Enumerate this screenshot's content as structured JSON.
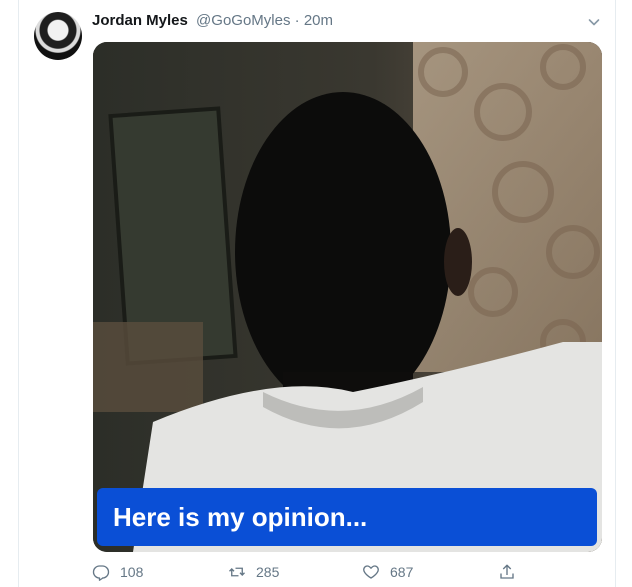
{
  "tweet": {
    "author_name": "Jordan Myles",
    "handle": "@GoGoMyles",
    "separator": "·",
    "time": "20m",
    "caption": "Here is my opinion...",
    "reply_count": "108",
    "retweet_count": "285",
    "like_count": "687"
  },
  "icons": {
    "reply": "reply-icon",
    "retweet": "retweet-icon",
    "like": "heart-icon",
    "share": "share-icon",
    "menu": "chevron-down-icon"
  },
  "colors": {
    "caption_bg": "#0a4fd6",
    "muted_text": "#657786",
    "name_text": "#14171a"
  }
}
